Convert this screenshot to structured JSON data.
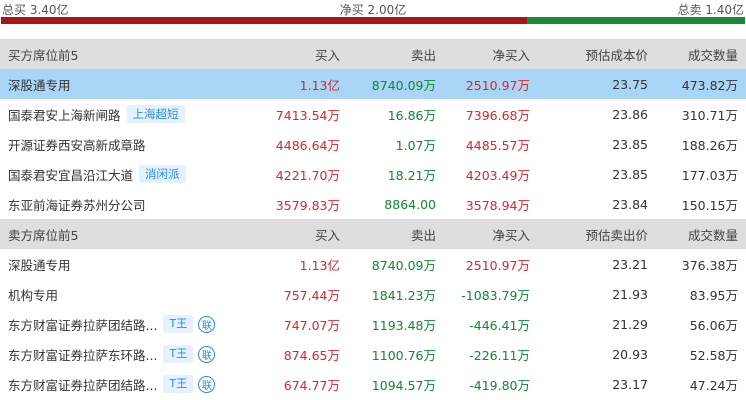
{
  "summary": {
    "total_buy": "总买 3.40亿",
    "net_buy": "净买 2.00亿",
    "total_sell": "总卖 1.40亿",
    "colors": {
      "buy_bar": "#a8161a",
      "sell_bar": "#1c8a34"
    }
  },
  "buy_section": {
    "headers": [
      "买方席位前5",
      "买入",
      "卖出",
      "净买入",
      "预估成本价",
      "成交数量"
    ],
    "rows": [
      {
        "name": "深股通专用",
        "tag": "",
        "buy": "1.13亿",
        "sell": "8740.09万",
        "net": "2510.97万",
        "price": "23.75",
        "volume": "473.82万",
        "highlighted": true
      },
      {
        "name": "国泰君安上海新闸路",
        "tag": "上海超短",
        "buy": "7413.54万",
        "sell": "16.86万",
        "net": "7396.68万",
        "price": "23.86",
        "volume": "310.71万"
      },
      {
        "name": "开源证券西安高新成章路",
        "tag": "",
        "buy": "4486.64万",
        "sell": "1.07万",
        "net": "4485.57万",
        "price": "23.85",
        "volume": "188.26万"
      },
      {
        "name": "国泰君安宜昌沿江大道",
        "tag": "消闲派",
        "buy": "4221.70万",
        "sell": "18.21万",
        "net": "4203.49万",
        "price": "23.85",
        "volume": "177.03万"
      },
      {
        "name": "东亚前海证券苏州分公司",
        "tag": "",
        "buy": "3579.83万",
        "sell": "8864.00",
        "net": "3578.94万",
        "price": "23.84",
        "volume": "150.15万"
      }
    ]
  },
  "sell_section": {
    "headers": [
      "卖方席位前5",
      "买入",
      "卖出",
      "净买入",
      "预估卖出价",
      "成交数量"
    ],
    "rows": [
      {
        "name": "深股通专用",
        "buy": "1.13亿",
        "sell": "8740.09万",
        "net": "2510.97万",
        "price": "23.21",
        "volume": "376.38万"
      },
      {
        "name": "机构专用",
        "buy": "757.44万",
        "sell": "1841.23万",
        "net": "-1083.79万",
        "price": "21.93",
        "volume": "83.95万"
      },
      {
        "name": "东方财富证券拉萨团结路...",
        "ttag": "T王",
        "link": "联",
        "buy": "747.07万",
        "sell": "1193.48万",
        "net": "-446.41万",
        "price": "21.29",
        "volume": "56.06万"
      },
      {
        "name": "东方财富证券拉萨东环路...",
        "ttag": "T王",
        "link": "联",
        "buy": "874.65万",
        "sell": "1100.76万",
        "net": "-226.11万",
        "price": "20.93",
        "volume": "52.58万"
      },
      {
        "name": "东方财富证券拉萨团结路...",
        "ttag": "T王",
        "link": "联",
        "buy": "674.77万",
        "sell": "1094.57万",
        "net": "-419.80万",
        "price": "23.17",
        "volume": "47.24万"
      }
    ]
  }
}
